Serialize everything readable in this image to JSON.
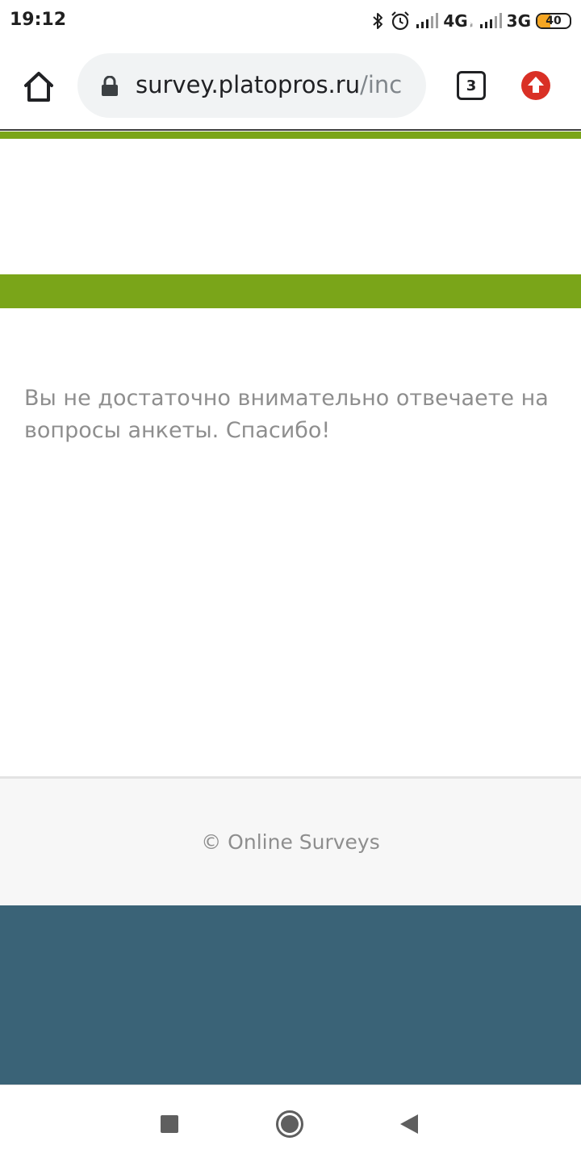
{
  "status_bar": {
    "time": "19:12",
    "network_primary": "4G",
    "network_primary_sub": "ᵢₗ",
    "network_secondary": "3G",
    "battery_level": "40",
    "battery_fraction": 0.4,
    "battery_color": "#f5a623",
    "icons": [
      "bluetooth-icon",
      "alarm-icon",
      "signal-icon",
      "signal-icon"
    ]
  },
  "browser": {
    "url_domain": "survey.platopros.ru",
    "url_path": "/inc",
    "tab_count": "3",
    "home_icon": "home-icon",
    "lock_icon": "lock-icon",
    "update_icon": "update-arrow-icon",
    "update_color": "#d93025"
  },
  "page": {
    "accent_color": "#7aa519",
    "message": "Вы не достаточно внимательно отвечаете на вопросы анкеты. Спасибо!",
    "footer_text": "© Online Surveys",
    "footer_band_color": "#3a6377"
  },
  "nav_bar": {
    "icons": [
      "recent-apps-icon",
      "home-circle-icon",
      "back-icon"
    ]
  }
}
